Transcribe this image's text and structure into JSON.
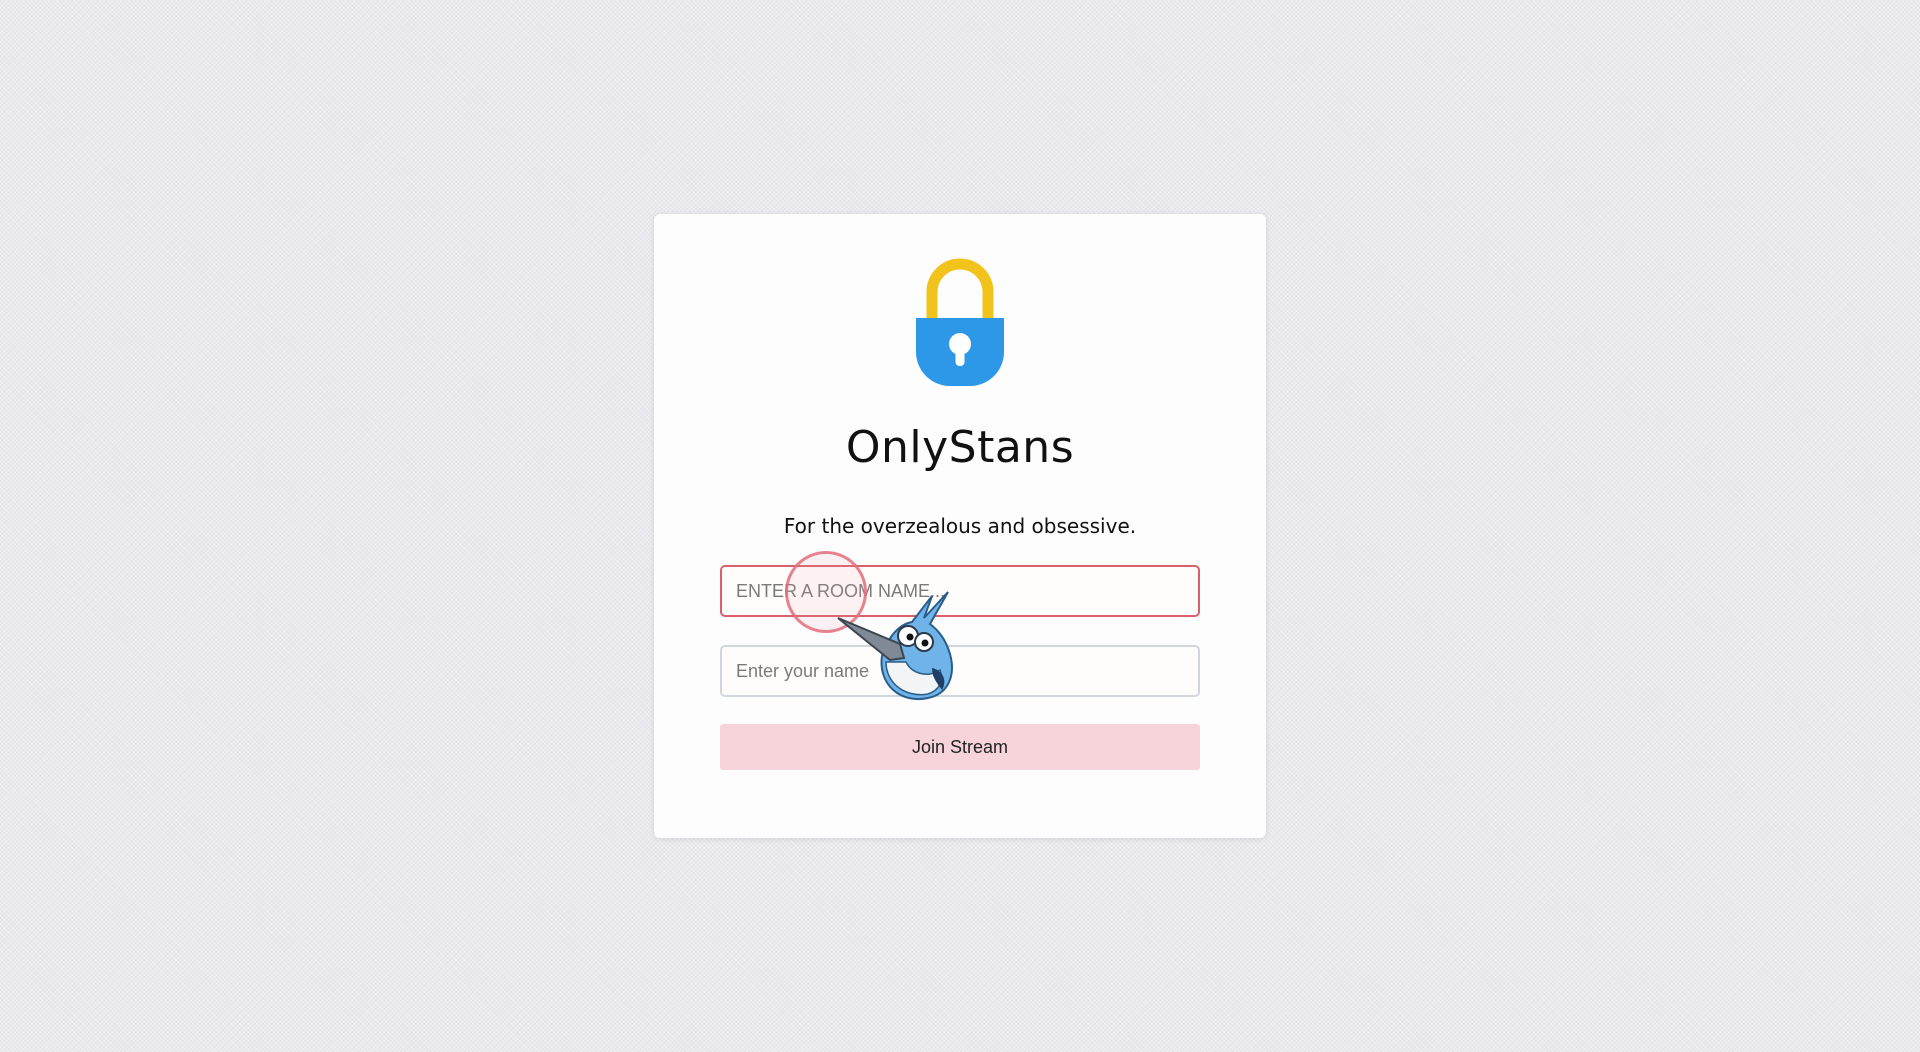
{
  "app": {
    "title": "OnlyStans",
    "tagline": "For the overzealous and obsessive."
  },
  "form": {
    "room_placeholder": "ENTER A ROOM NAME...",
    "room_value": "",
    "name_placeholder": "Enter your name",
    "name_value": "",
    "join_label": "Join Stream"
  },
  "icons": {
    "logo": "padlock-icon",
    "cursor_overlay": "bluejay-mascot-cursor"
  },
  "colors": {
    "lock_shackle": "#f2c31a",
    "lock_body": "#2d98e8",
    "room_field_border": "#d9606c",
    "join_button_bg": "#f7d3da",
    "background": "#e9e9ee"
  }
}
